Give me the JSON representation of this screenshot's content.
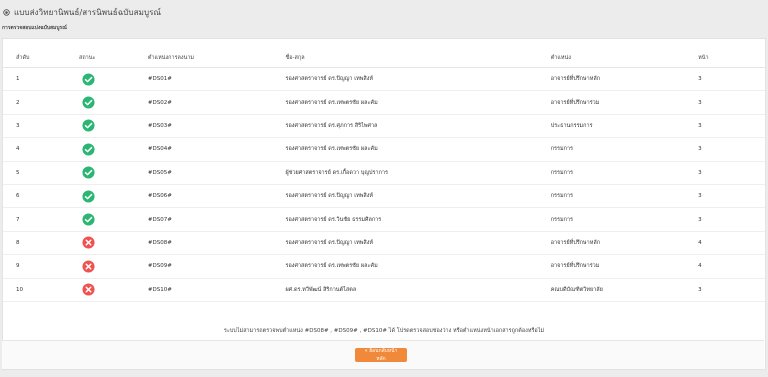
{
  "header": {
    "title": "แบบส่งวิทยานิพนธ์/สารนิพนธ์ฉบับสมบูรณ์",
    "subtitle": "การตรวจสอบแบ่งฉบับสมบูรณ์"
  },
  "table": {
    "columns": [
      "ลำดับ",
      "สถานะ",
      "ตำแหน่งการลงนาม",
      "ชื่อ-สกุล",
      "ตำแหน่ง",
      "หน้า"
    ],
    "rows": [
      {
        "no": "1",
        "status": "ok",
        "code": "#DS01#",
        "name": "รองศาสตราจารย์ ดร.ปิญญา เทพสิงห์",
        "position": "อาจารย์ที่ปรึกษาหลัก",
        "page": "3"
      },
      {
        "no": "2",
        "status": "ok",
        "code": "#DS02#",
        "name": "รองศาสตราจารย์ ดร.เทพตรชัย ผละคัม",
        "position": "อาจารย์ที่ปรึกษาร่วม",
        "page": "3"
      },
      {
        "no": "3",
        "status": "ok",
        "code": "#DS03#",
        "name": "รองศาสตราจารย์ ดร.ศุภการ สิริไพศาล",
        "position": "ประธานกรรมการ",
        "page": "3"
      },
      {
        "no": "4",
        "status": "ok",
        "code": "#DS04#",
        "name": "รองศาสตราจารย์ ดร.เทพตรชัย ผละคัม",
        "position": "กรรมการ",
        "page": "3"
      },
      {
        "no": "5",
        "status": "ok",
        "code": "#DS05#",
        "name": "ผู้ช่วยศาสตราจารย์ ดร.เกื้อดวา บุญปราการ",
        "position": "กรรมการ",
        "page": "3"
      },
      {
        "no": "6",
        "status": "ok",
        "code": "#DS06#",
        "name": "รองศาสตราจารย์ ดร.ปิญญา เทพสิงห์",
        "position": "กรรมการ",
        "page": "3"
      },
      {
        "no": "7",
        "status": "ok",
        "code": "#DS07#",
        "name": "รองศาสตราจารย์ ดร.วินชัย ธรรมศิลการ",
        "position": "กรรมการ",
        "page": "3"
      },
      {
        "no": "8",
        "status": "error",
        "code": "#DS08#",
        "name": "รองศาสตราจารย์ ดร.ปิญญา เทพสิงห์",
        "position": "อาจารย์ที่ปรึกษาหลัก",
        "page": "4"
      },
      {
        "no": "9",
        "status": "error",
        "code": "#DS09#",
        "name": "รองศาสตราจารย์ ดร.เทพตรชัย ผละคัม",
        "position": "อาจารย์ที่ปรึกษาร่วม",
        "page": "4"
      },
      {
        "no": "10",
        "status": "error",
        "code": "#DS10#",
        "name": "ผศ.ดร.ทวีพัฒน์ สิริกานต์ไสตล",
        "position": "คณบดีบัณฑิตวิทยาลัย",
        "page": "3"
      }
    ]
  },
  "footer_note": "ระบบไม่สามารถตรวจพบตำแหน่ง #DS08# , #DS09# , #DS10# ได้ โปรดตรวจสอบช่องว่าง หรือตำแหน่งหน้าเอกสารถูกต้องหรือไม่",
  "back_button_label": "« ย้อนกลับหน้าหลัก",
  "colors": {
    "ok": "#2bb673",
    "error": "#ef5350",
    "accent": "#f0893a"
  }
}
